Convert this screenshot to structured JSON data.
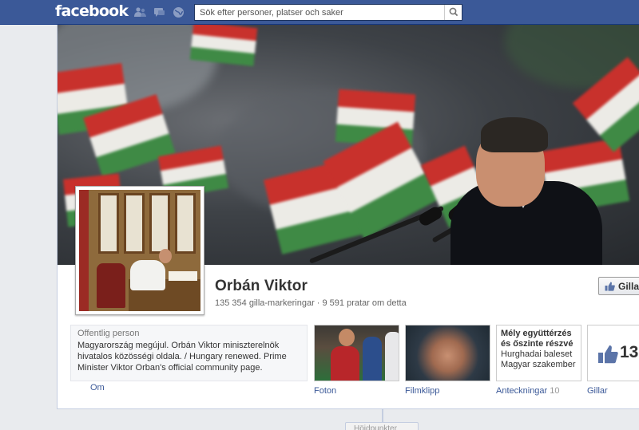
{
  "topbar": {
    "logo": "facebook",
    "jewels": [
      "friend-requests-icon",
      "messages-icon",
      "notifications-icon"
    ],
    "search_placeholder": "Sök efter personer, platser och saker",
    "bar_color": "#3b5998"
  },
  "page": {
    "name": "Orbán Viktor",
    "stats": "135 354 gilla-markeringar · 9 591 pratar om detta",
    "like_button": "Gilla"
  },
  "about": {
    "category": "Offentlig person",
    "description": "Magyarország megújul. Orbán Viktor miniszterelnök hivatalos közösségi oldala. / Hungary renewed. Prime Minister Viktor Orban's official community page.",
    "label": "Om"
  },
  "apps": {
    "photos": {
      "label": "Foton"
    },
    "videos": {
      "label": "Filmklipp"
    },
    "notes": {
      "label": "Anteckningar",
      "count": "10",
      "preview_title_1": "Mély együttérzés",
      "preview_title_2": "és őszinte részvé",
      "preview_line_1": "Hurghadai baleset",
      "preview_line_2": "Magyar szakember"
    },
    "likes": {
      "label": "Gillar",
      "count": "13"
    }
  },
  "timeline": {
    "bottom_button": "Höjdpunkter"
  }
}
